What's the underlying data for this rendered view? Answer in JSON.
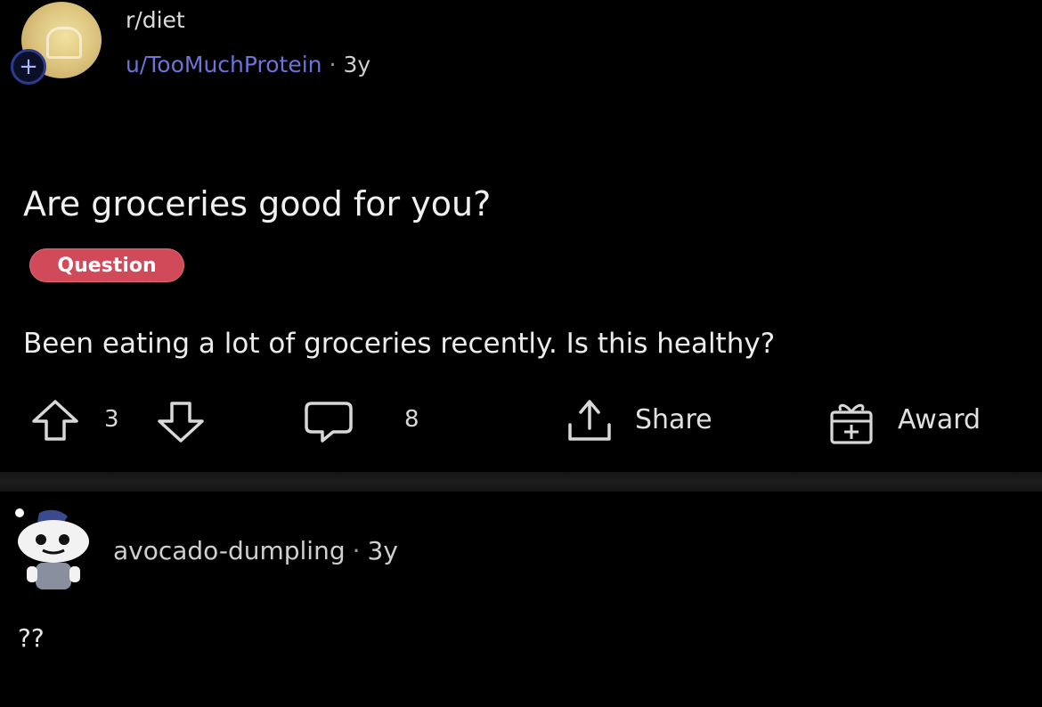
{
  "post": {
    "subreddit": "r/diet",
    "author": "u/TooMuchProtein",
    "separator": "·",
    "age": "3y",
    "title": "Are groceries good for you?",
    "flair": "Question",
    "body": "Been eating a lot of groceries recently. Is this healthy?",
    "vote_count": "3",
    "comment_count": "8",
    "share_label": "Share",
    "award_label": "Award"
  },
  "comment": {
    "author": "avocado-dumpling",
    "separator": "·",
    "age": "3y",
    "text": "??"
  },
  "colors": {
    "background": "#000000",
    "username": "#6d73d8",
    "flair": "#d14a5a"
  },
  "icons": [
    "plus-icon",
    "upvote-icon",
    "downvote-icon",
    "comment-icon",
    "share-icon",
    "award-icon",
    "snoo-avatar-icon"
  ]
}
